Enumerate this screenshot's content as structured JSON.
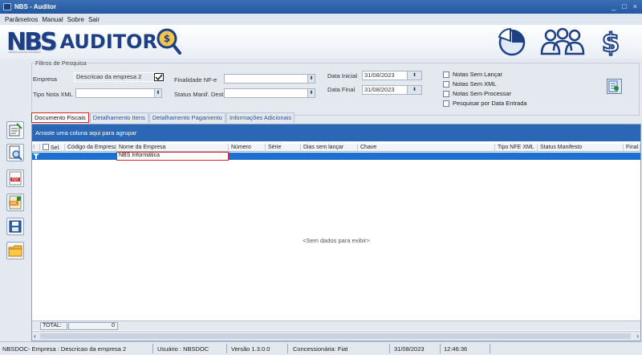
{
  "window": {
    "title": "NBS - Auditor",
    "controls": [
      "_",
      "□",
      "×"
    ]
  },
  "menu": [
    "Parâmetros",
    "Manual",
    "Sobre",
    "Sair"
  ],
  "banner": {
    "logo_nbs": "NBS",
    "logo_auditor": "AUDITOR",
    "logo_tag": "TECNOLOGIA EM SISTEMAS"
  },
  "filters": {
    "legend": "Filtros de Pesquisa",
    "empresa_label": "Empresa",
    "empresa_value": "Descricao da empresa 2",
    "tipo_nota_label": "Tipo Nota XML",
    "tipo_nota_value": "",
    "finalidade_label": "Finalidade NF-e",
    "finalidade_value": "",
    "status_manif_label": "Status Manif. Dest:",
    "status_manif_value": "",
    "data_inicial_label": "Data Inicial",
    "data_inicial_value": "31/08/2023",
    "data_final_label": "Data Final",
    "data_final_value": "31/08/2023",
    "checks": [
      "Notas Sem Lançar",
      "Notas Sem XML",
      "Notas Sem Processar",
      "Pesquisar por Data Entrada"
    ]
  },
  "tabs": [
    "Documento Fiscais",
    "Detalhamento Itens",
    "Detalhamento Pagamento",
    "Informações Adicionais"
  ],
  "grid": {
    "group_hint": "Arraste uma coluna aqui para agrupar",
    "columns": [
      "Sel.",
      "Código da Empresa",
      "Nome da Empresa",
      "Número",
      "Série",
      "Dias sem lançar",
      "Chave",
      "Tipo NFE XML",
      "Status Manifesto",
      "Final"
    ],
    "filter_value": "NBS Informática",
    "empty_text": "<Sem dados para exibir>",
    "total_label": "TOTAL:",
    "total_value": "0"
  },
  "status": {
    "company": "NBSDOC- Empresa : Descricao da empresa 2",
    "user": "Usuário : NBSDOC",
    "version": "Versão 1.3.0.0",
    "dealer": "Concessionária: Fiat",
    "date": "31/08/2023",
    "time": "12:46:36"
  },
  "colors": {
    "accent": "#2b67b4",
    "selected_row": "#1d6fd1",
    "brand": "#1d3f83",
    "highlight": "#dd2222"
  }
}
